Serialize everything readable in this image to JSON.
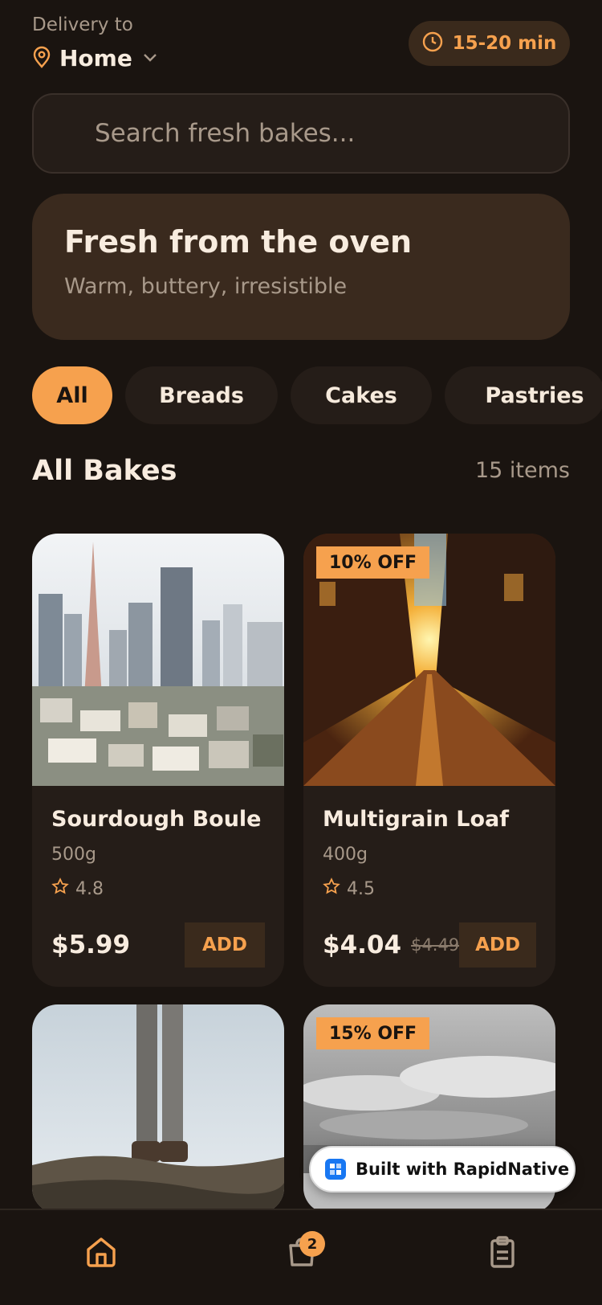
{
  "header": {
    "delivery_label": "Delivery to",
    "location": "Home",
    "eta": "15-20 min"
  },
  "search": {
    "placeholder": "Search fresh bakes..."
  },
  "hero": {
    "title": "Fresh from the oven",
    "subtitle": "Warm, buttery, irresistible"
  },
  "categories": [
    "All",
    "Breads",
    "Cakes",
    "Pastries"
  ],
  "active_category": "All",
  "section": {
    "title": "All Bakes",
    "count": "15 items"
  },
  "products": [
    {
      "name": "Sourdough Boule",
      "weight": "500g",
      "rating": "4.8",
      "price": "$5.99",
      "old_price": "",
      "discount": "",
      "add_label": "ADD",
      "image": "city-skyline-photo"
    },
    {
      "name": "Multigrain Loaf",
      "weight": "400g",
      "rating": "4.5",
      "price": "$4.04",
      "old_price": "$4.49",
      "discount": "10% OFF",
      "add_label": "ADD",
      "image": "sunset-street-photo"
    },
    {
      "name": "",
      "weight": "",
      "rating": "",
      "price": "",
      "old_price": "",
      "discount": "",
      "add_label": "",
      "image": "hiker-boots-photo"
    },
    {
      "name": "",
      "weight": "",
      "rating": "",
      "price": "",
      "old_price": "",
      "discount": "15% OFF",
      "add_label": "",
      "image": "cloudy-sky-photo"
    }
  ],
  "badge": {
    "label": "Built with RapidNative"
  },
  "bottom_nav": {
    "items": [
      {
        "icon": "home-icon",
        "active": true
      },
      {
        "icon": "cart-icon",
        "active": false,
        "badge": "2"
      },
      {
        "icon": "orders-icon",
        "active": false
      }
    ]
  },
  "colors": {
    "background": "#1a1410",
    "accent": "#f6a14e",
    "card": "#251d18",
    "muted_text": "#a8998a"
  }
}
